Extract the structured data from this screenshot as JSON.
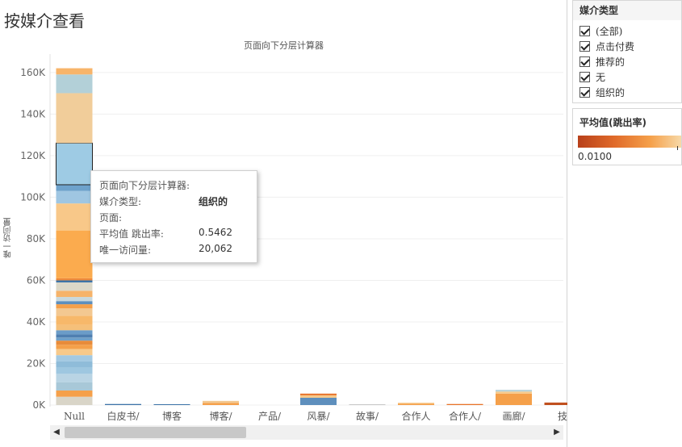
{
  "page": {
    "title": "按媒介查看"
  },
  "chart_data": {
    "type": "bar",
    "stacked": true,
    "title": "页面向下分层计算器",
    "ylabel": "唯一访问量",
    "xlabel": "",
    "ylim": [
      0,
      165000
    ],
    "yticks": [
      0,
      20000,
      40000,
      60000,
      80000,
      100000,
      120000,
      140000,
      160000
    ],
    "ytick_labels": [
      "0K",
      "20K",
      "40K",
      "60K",
      "80K",
      "100K",
      "120K",
      "140K",
      "160K"
    ],
    "categories": [
      "Null",
      "白皮书/",
      "博客",
      "博客/",
      "产品/",
      "风暴/",
      "故事/",
      "合作人",
      "合作人/",
      "画廊/",
      "技"
    ],
    "stacks": [
      {
        "category": "Null",
        "segments": [
          {
            "value": 4000,
            "color": "#d9d5c8"
          },
          {
            "value": 3000,
            "color": "#f5a04a"
          },
          {
            "value": 4000,
            "color": "#a8c8d8"
          },
          {
            "value": 4000,
            "color": "#b9d4e4"
          },
          {
            "value": 3000,
            "color": "#9ec7e0"
          },
          {
            "value": 3000,
            "color": "#8fbcd9"
          },
          {
            "value": 3000,
            "color": "#a3c9e2"
          },
          {
            "value": 3000,
            "color": "#f7c98a"
          },
          {
            "value": 2000,
            "color": "#f5a04a"
          },
          {
            "value": 2000,
            "color": "#e88b3a"
          },
          {
            "value": 1500,
            "color": "#6fa0c8"
          },
          {
            "value": 1500,
            "color": "#4f7fb0"
          },
          {
            "value": 2000,
            "color": "#6b9cc8"
          },
          {
            "value": 2500,
            "color": "#f5c07a"
          },
          {
            "value": 4500,
            "color": "#f7b86a"
          },
          {
            "value": 3500,
            "color": "#f3c891"
          },
          {
            "value": 2000,
            "color": "#f5a04a"
          },
          {
            "value": 1500,
            "color": "#5e8fbd"
          },
          {
            "value": 2000,
            "color": "#c8d8de"
          },
          {
            "value": 3000,
            "color": "#f6b36a"
          },
          {
            "value": 4000,
            "color": "#dcd8c8"
          },
          {
            "value": 1000,
            "color": "#3e74a8"
          },
          {
            "value": 1000,
            "color": "#ee8a3a"
          },
          {
            "value": 23000,
            "color": "#fbab4e"
          },
          {
            "value": 13000,
            "color": "#f8c889"
          },
          {
            "value": 6000,
            "color": "#9fc6e2"
          },
          {
            "value": 3000,
            "color": "#6ea2cc"
          },
          {
            "value": 20062,
            "color": "#9ecbe4",
            "highlight": true
          },
          {
            "value": 24000,
            "color": "#f1cd9a"
          },
          {
            "value": 9000,
            "color": "#b3d0d8"
          },
          {
            "value": 3000,
            "color": "#f7b46a"
          }
        ]
      },
      {
        "category": "白皮书/",
        "segments": [
          {
            "value": 500,
            "color": "#3e74a8"
          }
        ]
      },
      {
        "category": "博客",
        "segments": [
          {
            "value": 400,
            "color": "#3e74a8"
          }
        ]
      },
      {
        "category": "博客/",
        "segments": [
          {
            "value": 1000,
            "color": "#f5a04a"
          },
          {
            "value": 1000,
            "color": "#f3c891"
          }
        ]
      },
      {
        "category": "产品/",
        "segments": [
          {
            "value": 0,
            "color": "#f5a04a"
          }
        ]
      },
      {
        "category": "风暴/",
        "segments": [
          {
            "value": 3500,
            "color": "#5e8fbd"
          },
          {
            "value": 1200,
            "color": "#f7c98a"
          },
          {
            "value": 800,
            "color": "#e8742a"
          }
        ]
      },
      {
        "category": "故事/",
        "segments": [
          {
            "value": 300,
            "color": "#c8c8c8"
          }
        ]
      },
      {
        "category": "合作人",
        "segments": [
          {
            "value": 700,
            "color": "#f5a04a"
          },
          {
            "value": 400,
            "color": "#f7c98a"
          }
        ]
      },
      {
        "category": "合作人/",
        "segments": [
          {
            "value": 500,
            "color": "#e8742a"
          }
        ]
      },
      {
        "category": "画廊/",
        "segments": [
          {
            "value": 5500,
            "color": "#f5a04a"
          },
          {
            "value": 1000,
            "color": "#f7c98a"
          },
          {
            "value": 800,
            "color": "#b3d0d8"
          }
        ]
      },
      {
        "category": "技",
        "segments": [
          {
            "value": 1200,
            "color": "#c0501f"
          }
        ]
      }
    ]
  },
  "tooltip": {
    "title": "页面向下分层计算器:",
    "medium_label": "媒介类型:",
    "medium_value": "组织的",
    "page_label": "页面:",
    "bounce_label": "平均值 跳出率:",
    "bounce_value": "0.5462",
    "visits_label": "唯一访问量:",
    "visits_value": "20,062"
  },
  "filter": {
    "title": "媒介类型",
    "items": [
      {
        "label": "(全部)",
        "checked": true
      },
      {
        "label": "点击付费",
        "checked": true
      },
      {
        "label": "推荐的",
        "checked": true
      },
      {
        "label": "无",
        "checked": true
      },
      {
        "label": "组织的",
        "checked": true
      }
    ]
  },
  "legend": {
    "title": "平均值(跳出率)",
    "min_label": "0.0100",
    "colors": [
      "#b8401a",
      "#e06a2a",
      "#f5a04a",
      "#f7d9a8"
    ]
  },
  "scrollbar": {
    "left_arrow": "◀",
    "right_arrow": "▶"
  }
}
